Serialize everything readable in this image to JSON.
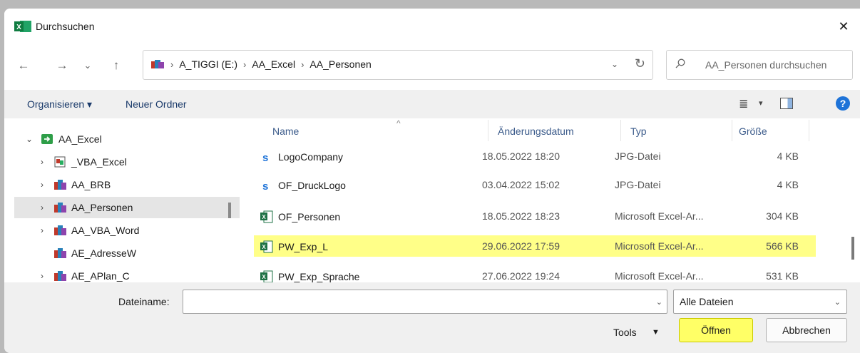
{
  "window": {
    "title": "Durchsuchen",
    "app_icon": "excel-icon",
    "close": "✕"
  },
  "nav": {
    "back": "←",
    "forward": "→",
    "recent": "⌄",
    "up": "↑"
  },
  "breadcrumb": {
    "items": [
      "A_TIGGI (E:)",
      "AA_Excel",
      "AA_Personen"
    ],
    "separator": "›",
    "drop": "⌄",
    "refresh": "↻"
  },
  "search": {
    "placeholder": "AA_Personen durchsuchen"
  },
  "toolbar": {
    "organize": "Organisieren ▾",
    "new_folder": "Neuer Ordner",
    "view_drop": "▾",
    "help": "?"
  },
  "tree": {
    "items": [
      {
        "label": "AA_Excel",
        "chevron": "⌄"
      },
      {
        "label": "_VBA_Excel",
        "chevron": "›"
      },
      {
        "label": "AA_BRB",
        "chevron": "›"
      },
      {
        "label": "AA_Personen",
        "chevron": "›"
      },
      {
        "label": "AA_VBA_Word",
        "chevron": "›"
      },
      {
        "label": "AE_AdresseW",
        "chevron": ""
      },
      {
        "label": "AE_APlan_C",
        "chevron": "›"
      }
    ]
  },
  "columns": {
    "name": "Name",
    "date": "Änderungsdatum",
    "type": "Typ",
    "size": "Größe",
    "sort_caret": "^"
  },
  "files": [
    {
      "name": "LogoCompany",
      "date": "18.05.2022 18:20",
      "type": "JPG-Datei",
      "size": "4 KB",
      "icon": "jpg-file-icon"
    },
    {
      "name": "OF_DruckLogo",
      "date": "03.04.2022 15:02",
      "type": "JPG-Datei",
      "size": "4 KB",
      "icon": "jpg-file-icon"
    },
    {
      "name": "OF_Personen",
      "date": "18.05.2022 18:23",
      "type": "Microsoft Excel-Ar...",
      "size": "304 KB",
      "icon": "excel-file-icon"
    },
    {
      "name": "PW_Exp_L",
      "date": "29.06.2022 17:59",
      "type": "Microsoft Excel-Ar...",
      "size": "566 KB",
      "icon": "excel-file-icon"
    },
    {
      "name": "PW_Exp_Sprache",
      "date": "27.06.2022 19:24",
      "type": "Microsoft Excel-Ar...",
      "size": "531 KB",
      "icon": "excel-file-icon"
    }
  ],
  "bottom": {
    "filename_label": "Dateiname:",
    "filename_value": "",
    "filename_drop": "⌄",
    "filter_value": "Alle Dateien",
    "filter_drop": "⌄",
    "tools": "Tools",
    "tools_drop": "▼",
    "open": "Öffnen",
    "cancel": "Abbrechen"
  },
  "colors": {
    "highlight": "#ffff88",
    "open_button": "#ffff66",
    "help_blue": "#1e73d8"
  }
}
